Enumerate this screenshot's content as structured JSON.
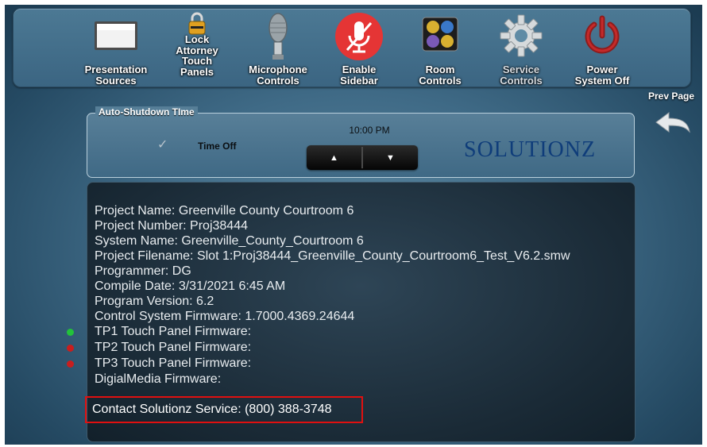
{
  "toolbar": {
    "items": [
      {
        "label1": "Presentation",
        "label2": "Sources",
        "label3": ""
      },
      {
        "label1": "Lock",
        "label2": "Attorney",
        "label3": "Touch",
        "label4": "Panels"
      },
      {
        "label1": "Microphone",
        "label2": "Controls",
        "label3": ""
      },
      {
        "label1": "Enable",
        "label2": "Sidebar",
        "label3": ""
      },
      {
        "label1": "Room",
        "label2": "Controls",
        "label3": ""
      },
      {
        "label1": "Service",
        "label2": "Controls",
        "label3": ""
      },
      {
        "label1": "Power",
        "label2": "System Off",
        "label3": ""
      }
    ]
  },
  "prev_page": {
    "label": "Prev Page"
  },
  "shutdown": {
    "legend": "Auto-Shutdown TIme",
    "time_off_label": "Time Off",
    "time_off_checked": true,
    "time_value": "10:00 PM",
    "brand": "SOLUTIONZ"
  },
  "info": {
    "lines": [
      "Project Name:  Greenville County Courtroom 6",
      "Project Number: Proj38444",
      "System Name: Greenville_County_Courtroom 6",
      "Project Filename: Slot 1:Proj38444_Greenville_County_Courtroom6_Test_V6.2.smw",
      "Programmer: DG",
      "Compile Date: 3/31/2021 6:45 AM",
      "Program Version: 6.2",
      "Control System Firmware: 1.7000.4369.24644",
      "TP1 Touch Panel Firmware:",
      "TP2 Touch Panel Firmware:",
      "TP3 Touch Panel Firmware:",
      "DigialMedia Firmware:"
    ],
    "status": {
      "tp1": "#22c23a",
      "tp2": "#c81e1e",
      "tp3": "#c81e1e"
    },
    "contact": "Contact Solutionz Service: (800) 388-3748"
  },
  "colors": {
    "accent_red": "#e53535",
    "brand_blue": "#0f3d7a",
    "highlight_box": "#e01010"
  }
}
